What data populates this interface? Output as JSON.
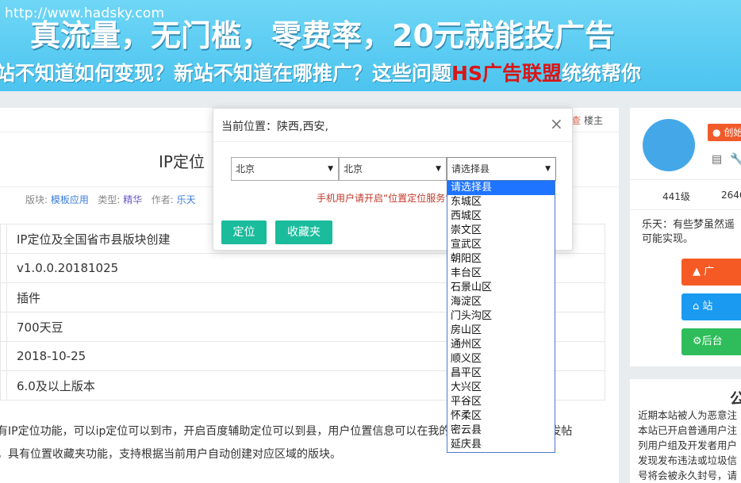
{
  "banner": {
    "url": "http://www.hadsky.com",
    "line1": "真流量，无门槛，零费率，20元就能投广告",
    "line2_pre": "站不知道如何变现？新站不知道在哪推广？这些问题",
    "line2_hl": "HS广告联盟",
    "line2_post": "统统帮你"
  },
  "post": {
    "louzhu_prefix": "查",
    "louzhu_label": "楼主",
    "title_partial": "IP定位",
    "meta": {
      "section_label": "版块:",
      "section_value": "模板应用",
      "type_label": "类型:",
      "type_value": "精华",
      "author_label": "作者:",
      "author_value": "乐天"
    },
    "info_rows": [
      "IP定位及全国省市县版块创建",
      "v1.0.0.20181025",
      "插件",
      "700天豆",
      "2018-10-25",
      "6.0及以上版本"
    ],
    "desc": [
      "有IP定位功能，可以ip定位可以到市，开启百度辅助定位可以到县，用户位置信息可以在我的资料页中显示，支持发帖",
      "，具有位置收藏夹功能，支持根据当前用户自动创建对应区域的版块。"
    ]
  },
  "sidebar": {
    "create_btn": "创始",
    "stats": [
      "441级",
      "2646"
    ],
    "bio": [
      "乐天：有些梦虽然遥",
      "可能实现。"
    ],
    "buttons": [
      "广",
      "站",
      "后台"
    ],
    "notice_title": "公",
    "notice_lines": [
      "近期本站被人为恶意注",
      "本站已开启普通用户注",
      "列用户组及开发者用户",
      "发现发布违法或垃圾信",
      "号将会被永久封号，请"
    ]
  },
  "modal": {
    "title": "当前位置：陕西,西安,",
    "close": "×",
    "province": "北京",
    "city": "北京",
    "county": "请选择县",
    "hint": "手机用户请开启“位置定位服务”",
    "locate_btn": "定位",
    "fav_btn": "收藏夹"
  },
  "dropdown": {
    "options": [
      "请选择县",
      "东城区",
      "西城区",
      "崇文区",
      "宣武区",
      "朝阳区",
      "丰台区",
      "石景山区",
      "海淀区",
      "门头沟区",
      "房山区",
      "通州区",
      "顺义区",
      "昌平区",
      "大兴区",
      "平谷区",
      "怀柔区",
      "密云县",
      "延庆县"
    ],
    "selected_index": 0
  },
  "colors": {
    "banner_bg": "#4cc4ef",
    "accent_green": "#1abc9c",
    "highlight_red": "#d91616",
    "select_blue": "#1e74ff"
  }
}
